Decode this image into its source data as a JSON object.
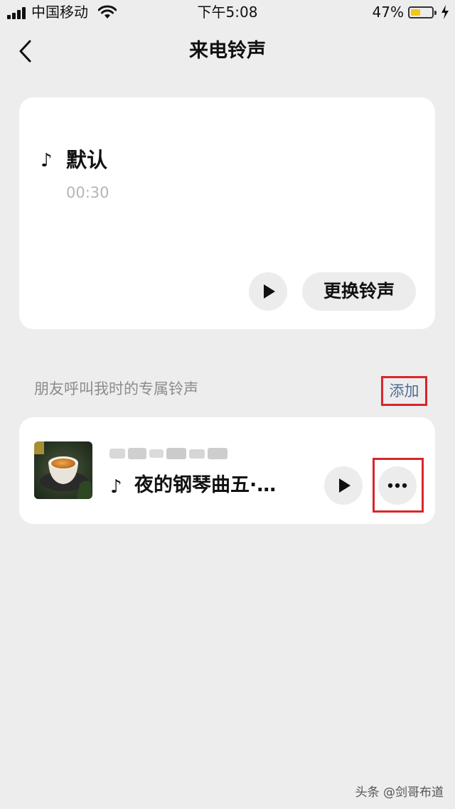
{
  "status_bar": {
    "carrier": "中国移动",
    "time": "下午5:08",
    "battery_percent": "47%",
    "battery_level": 0.47,
    "icons": [
      "signal-icon",
      "wifi-icon",
      "battery-icon",
      "charging-bolt-icon"
    ]
  },
  "nav": {
    "back_icon": "chevron-left-icon",
    "title": "来电铃声"
  },
  "default_ringtone": {
    "note_icon": "♪",
    "name": "默认",
    "duration": "00:30",
    "play_icon": "play-icon",
    "change_button_label": "更换铃声"
  },
  "friend_section": {
    "label": "朋友呼叫我时的专属铃声",
    "add_label": "添加"
  },
  "friend_ringtone": {
    "cover_icon": "tea-cup-image",
    "note_icon": "♪",
    "song": "夜的钢琴曲五·…",
    "play_icon": "play-icon",
    "more_icon": "more-dots-icon"
  },
  "watermark": "头条 @剑哥布道",
  "colors": {
    "background": "#ededed",
    "card": "#ffffff",
    "button_bg": "#ececec",
    "link": "#4d6a94",
    "highlight_box": "#d9262c",
    "battery_fill": "#f5c518"
  }
}
